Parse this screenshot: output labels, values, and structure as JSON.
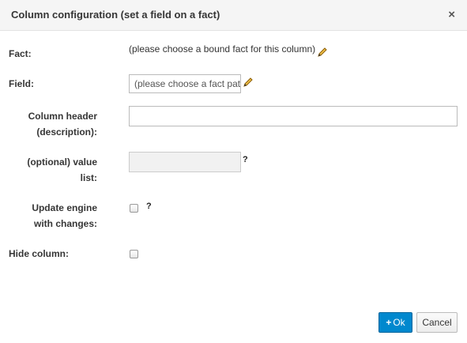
{
  "dialog": {
    "title": "Column configuration (set a field on a fact)",
    "close_glyph": "×"
  },
  "form": {
    "fact": {
      "label": "Fact:",
      "value": "(please choose a bound fact for this column)",
      "edit_icon": "pencil-icon"
    },
    "field": {
      "label": "Field:",
      "value": "(please choose a fact pattern first)",
      "edit_icon": "pencil-icon"
    },
    "column_header": {
      "label_line1": "Column header",
      "label_line2": "(description):",
      "value": ""
    },
    "value_list": {
      "label_line1": "(optional) value",
      "label_line2": "list:",
      "value": "",
      "help": "?"
    },
    "update_engine": {
      "label_line1": "Update engine",
      "label_line2": "with changes:",
      "checked": false,
      "help": "?"
    },
    "hide_column": {
      "label": "Hide column:",
      "checked": false
    }
  },
  "footer": {
    "ok_icon": "+",
    "ok_label": "Ok",
    "cancel_label": "Cancel"
  },
  "colors": {
    "primary_button": "#0088ce",
    "header_bg": "#f5f5f5"
  }
}
